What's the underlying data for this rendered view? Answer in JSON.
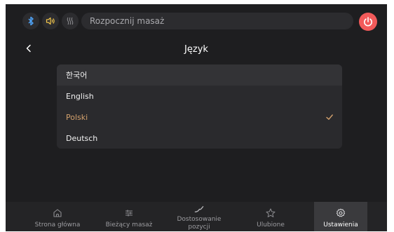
{
  "status_bar": {
    "bluetooth_icon": "bluetooth-icon",
    "volume_icon": "volume-icon",
    "heat_icon": "heat-icon",
    "start_label": "Rozpocznij masaż",
    "power_icon": "power-icon"
  },
  "header": {
    "title": "Język",
    "back_icon": "chevron-left-icon"
  },
  "languages": [
    {
      "label": "한국어",
      "selected": false
    },
    {
      "label": "English",
      "selected": false
    },
    {
      "label": "Polski",
      "selected": true
    },
    {
      "label": "Deutsch",
      "selected": false
    }
  ],
  "bottom_nav": [
    {
      "label": "Strona główna",
      "icon": "home-icon",
      "active": false
    },
    {
      "label": "Bieżący masaż",
      "icon": "sliders-icon",
      "active": false
    },
    {
      "label": "Dostosowanie pozycji",
      "icon": "adjust-icon",
      "active": false
    },
    {
      "label": "Ulubione",
      "icon": "star-icon",
      "active": false
    },
    {
      "label": "Ustawienia",
      "icon": "gear-icon",
      "active": true
    }
  ],
  "colors": {
    "background": "#1e1e20",
    "accent": "#d2a06c",
    "power": "#f25a5a",
    "bluetooth": "#4ea2f5",
    "volume": "#f2c64b"
  }
}
